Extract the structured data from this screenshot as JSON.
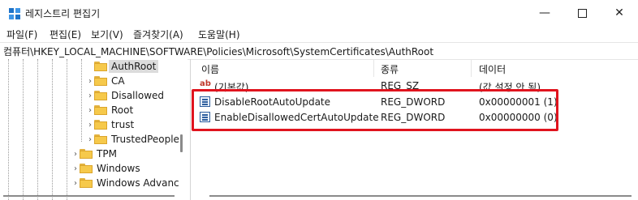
{
  "window": {
    "title": "레지스트리 편집기",
    "icon": "regedit-icon",
    "controls": [
      "minimize-icon",
      "maximize-icon",
      "close-icon"
    ]
  },
  "menu": [
    "파일(F)",
    "편집(E)",
    "보기(V)",
    "즐겨찾기(A)",
    "도움말(H)"
  ],
  "address": "컴퓨터\\HKEY_LOCAL_MACHINE\\SOFTWARE\\Policies\\Microsoft\\SystemCertificates\\AuthRoot",
  "tree": {
    "items": [
      {
        "label": "AuthRoot",
        "selected": true,
        "chevron": ""
      },
      {
        "label": "CA",
        "chevron": "›"
      },
      {
        "label": "Disallowed",
        "chevron": "›"
      },
      {
        "label": "Root",
        "chevron": "›"
      },
      {
        "label": "trust",
        "chevron": "›"
      },
      {
        "label": "TrustedPeople",
        "chevron": "›"
      },
      {
        "label": "TPM",
        "chevron": "›"
      },
      {
        "label": "Windows",
        "chevron": "›"
      },
      {
        "label": "Windows Advanc",
        "chevron": "›"
      }
    ]
  },
  "list": {
    "headers": {
      "name": "이름",
      "type": "종류",
      "data": "데이터"
    },
    "rows": [
      {
        "icon": "string-value-icon",
        "name": "(기본값)",
        "type": "REG_SZ",
        "data": "(값 설정 안 됨)"
      },
      {
        "icon": "dword-value-icon",
        "name": "DisableRootAutoUpdate",
        "type": "REG_DWORD",
        "data": "0x00000001 (1)"
      },
      {
        "icon": "dword-value-icon",
        "name": "EnableDisallowedCertAutoUpdate",
        "type": "REG_DWORD",
        "data": "0x00000000 (0)"
      }
    ]
  },
  "colors": {
    "highlight_box": "#e0141e",
    "selected_bg": "#dcdcdc"
  }
}
